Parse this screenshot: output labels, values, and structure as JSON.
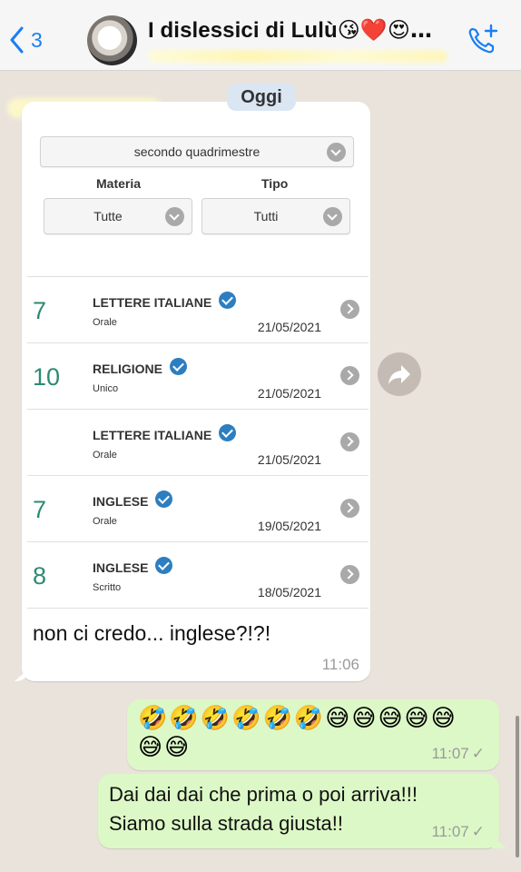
{
  "header": {
    "back_count": "3",
    "chat_title": "I dislessici di Lulù",
    "title_emojis": "😘❤️😍…"
  },
  "chat": {
    "day_label": "Oggi",
    "incoming": {
      "screenshot": {
        "period_select": "secondo quadrimestre",
        "subject_label": "Materia",
        "type_label": "Tipo",
        "subject_select": "Tutte",
        "type_select": "Tutti",
        "grades": [
          {
            "value": "7",
            "subject": "LETTERE ITALIANE",
            "type": "Orale",
            "date": "21/05/2021"
          },
          {
            "value": "10",
            "subject": "RELIGIONE",
            "type": "Unico",
            "date": "21/05/2021"
          },
          {
            "value": "",
            "subject": "LETTERE ITALIANE",
            "type": "Orale",
            "date": "21/05/2021"
          },
          {
            "value": "7",
            "subject": "INGLESE",
            "type": "Orale",
            "date": "19/05/2021"
          },
          {
            "value": "8",
            "subject": "INGLESE",
            "type": "Scritto",
            "date": "18/05/2021"
          }
        ]
      },
      "text": "non ci credo... inglese?!?!",
      "time": "11:06"
    },
    "outgoing": [
      {
        "emoji_line_1": "🤣🤣🤣🤣🤣🤣😅😅😅😅😅",
        "emoji_line_2": "😅😅",
        "time": "11:07",
        "status": "✓"
      },
      {
        "line_1": "Dai dai dai che prima o poi arriva!!!",
        "line_2": "Siamo sulla strada giusta!!",
        "time": "11:07",
        "status": "✓"
      }
    ]
  },
  "colors": {
    "accent": "#1a7ef4",
    "grade_green": "#2d8a72",
    "check_blue": "#2d7ec0",
    "outgoing_bubble": "#dcf8c6"
  },
  "icons": [
    "chevron-left-icon",
    "video-call-icon",
    "forward-icon",
    "check-icon",
    "chevron-right-icon"
  ]
}
